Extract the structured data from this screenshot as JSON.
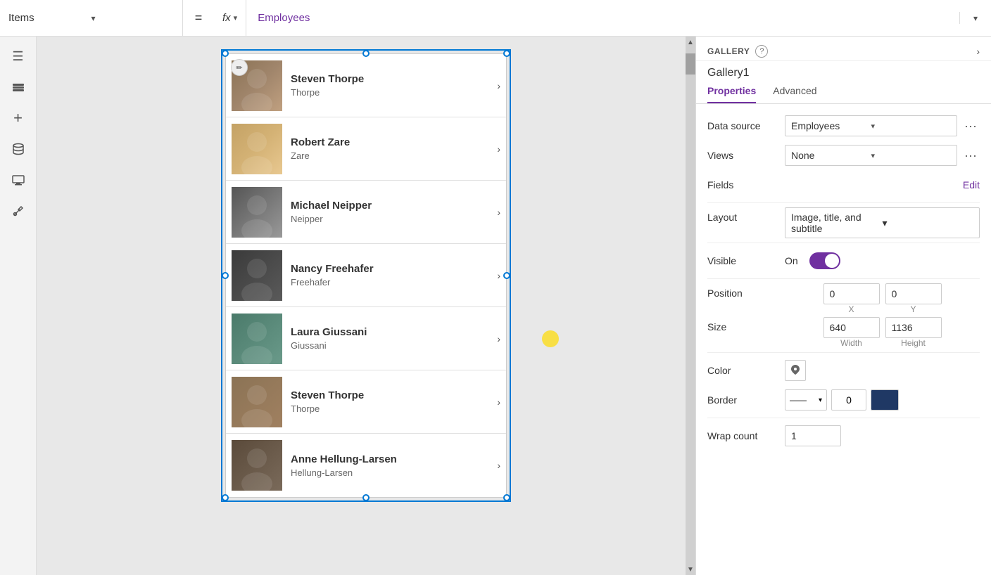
{
  "topbar": {
    "items_label": "Items",
    "items_chevron": "▾",
    "equals": "=",
    "fx_label": "fx",
    "fx_chevron": "▾",
    "formula": "Employees",
    "formula_chevron": "▾"
  },
  "sidebar": {
    "icons": [
      {
        "name": "hamburger-icon",
        "symbol": "☰"
      },
      {
        "name": "layers-icon",
        "symbol": "⊞"
      },
      {
        "name": "add-icon",
        "symbol": "+"
      },
      {
        "name": "database-icon",
        "symbol": "⬡"
      },
      {
        "name": "media-icon",
        "symbol": "▶"
      },
      {
        "name": "tools-icon",
        "symbol": "🔧"
      }
    ]
  },
  "gallery": {
    "items": [
      {
        "name": "Steven Thorpe",
        "subtitle": "Thorpe",
        "avatar_class": "avatar-1"
      },
      {
        "name": "Robert Zare",
        "subtitle": "Zare",
        "avatar_class": "avatar-2"
      },
      {
        "name": "Michael Neipper",
        "subtitle": "Neipper",
        "avatar_class": "avatar-3"
      },
      {
        "name": "Nancy Freehafer",
        "subtitle": "Freehafer",
        "avatar_class": "avatar-4"
      },
      {
        "name": "Laura Giussani",
        "subtitle": "Giussani",
        "avatar_class": "avatar-5"
      },
      {
        "name": "Steven Thorpe",
        "subtitle": "Thorpe",
        "avatar_class": "avatar-6"
      },
      {
        "name": "Anne Hellung-Larsen",
        "subtitle": "Hellung-Larsen",
        "avatar_class": "avatar-7"
      }
    ]
  },
  "panel": {
    "gallery_label": "GALLERY",
    "help_label": "?",
    "gallery_name": "Gallery1",
    "tabs": [
      "Properties",
      "Advanced"
    ],
    "active_tab": "Properties",
    "props": {
      "data_source_label": "Data source",
      "data_source_value": "Employees",
      "views_label": "Views",
      "views_value": "None",
      "fields_label": "Fields",
      "fields_edit": "Edit",
      "layout_label": "Layout",
      "layout_value": "Image, title, and subtitle",
      "visible_label": "Visible",
      "visible_on": "On",
      "position_label": "Position",
      "pos_x": "0",
      "pos_y": "0",
      "pos_x_label": "X",
      "pos_y_label": "Y",
      "size_label": "Size",
      "size_width": "640",
      "size_height": "1136",
      "size_width_label": "Width",
      "size_height_label": "Height",
      "color_label": "Color",
      "border_label": "Border",
      "border_value": "0",
      "wrap_count_label": "Wrap count",
      "wrap_count_value": "1"
    }
  }
}
